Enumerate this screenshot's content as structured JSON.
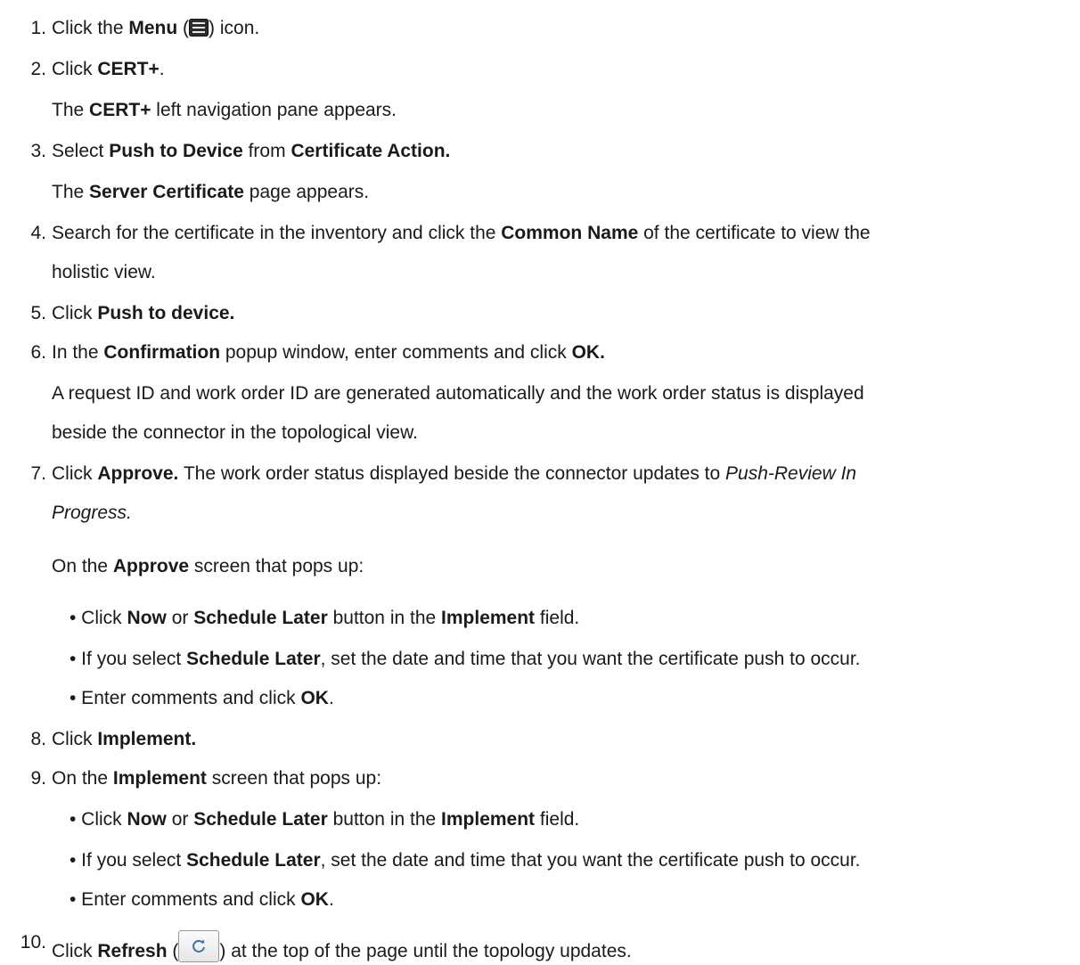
{
  "steps": {
    "s1": {
      "num": "1.",
      "a": "Click the ",
      "b1": "Menu",
      "c": " (",
      "d": ") icon."
    },
    "s2": {
      "num": "2.",
      "a": "Click ",
      "b1": "CERT+",
      "c": "."
    },
    "s2_note": {
      "a": "The ",
      "b1": "CERT+",
      "c": " left navigation pane appears."
    },
    "s3": {
      "num": "3.",
      "a": "Select ",
      "b1": "Push to Device",
      "c": " from ",
      "b2": "Certificate Action."
    },
    "s3_note": {
      "a": "The ",
      "b1": "Server Certificate",
      "c": " page appears."
    },
    "s4": {
      "num": "4.",
      "a": "Search for the certificate in the inventory and click the ",
      "b1": "Common Name",
      "c": " of the certificate to view the",
      "d": "holistic view."
    },
    "s5": {
      "num": "5.",
      "a": "Click ",
      "b1": "Push to device."
    },
    "s6": {
      "num": "6.",
      "a": "In the ",
      "b1": "Confirmation",
      "c": " popup window, enter comments and click ",
      "b2": "OK."
    },
    "s6_note": {
      "a": "A request ID and work order ID are generated automatically and the work order status is displayed",
      "b": "beside the connector in the topological view."
    },
    "s7": {
      "num": "7.",
      "a": "Click ",
      "b1": "Approve.",
      "c": " The work order status displayed beside the connector updates to ",
      "i1": "Push-Review In",
      "i2": "Progress."
    },
    "s7_note": {
      "a": "On the ",
      "b1": "Approve",
      "c": " screen that pops up:"
    },
    "s7_bullets": [
      {
        "a": "• Click ",
        "b1": "Now",
        "c": " or ",
        "b2": "Schedule Later",
        "d": " button in the ",
        "b3": "Implement",
        "e": " field."
      },
      {
        "a": "• If you select ",
        "b1": "Schedule Later",
        "c": ", set the date and time that you want the certificate push to occur."
      },
      {
        "a": "• Enter comments and click ",
        "b1": "OK",
        "c": "."
      }
    ],
    "s8": {
      "num": "8.",
      "a": "Click ",
      "b1": "Implement."
    },
    "s9": {
      "num": "9.",
      "a": "On the ",
      "b1": "Implement",
      "c": " screen that pops up:"
    },
    "s9_bullets": [
      {
        "a": "• Click ",
        "b1": "Now",
        "c": " or ",
        "b2": "Schedule Later",
        "d": " button in the ",
        "b3": "Implement",
        "e": " field."
      },
      {
        "a": "• If you select ",
        "b1": "Schedule Later",
        "c": ", set the date and time that you want the certificate push to occur."
      },
      {
        "a": "• Enter comments and click ",
        "b1": "OK",
        "c": "."
      }
    ],
    "s10": {
      "num": "10.",
      "a": "Click ",
      "b1": "Refresh",
      "c": " (",
      "d": ") at the top of the page until the topology updates."
    }
  },
  "icons": {
    "menu": "menu-icon",
    "refresh": "refresh-icon"
  }
}
